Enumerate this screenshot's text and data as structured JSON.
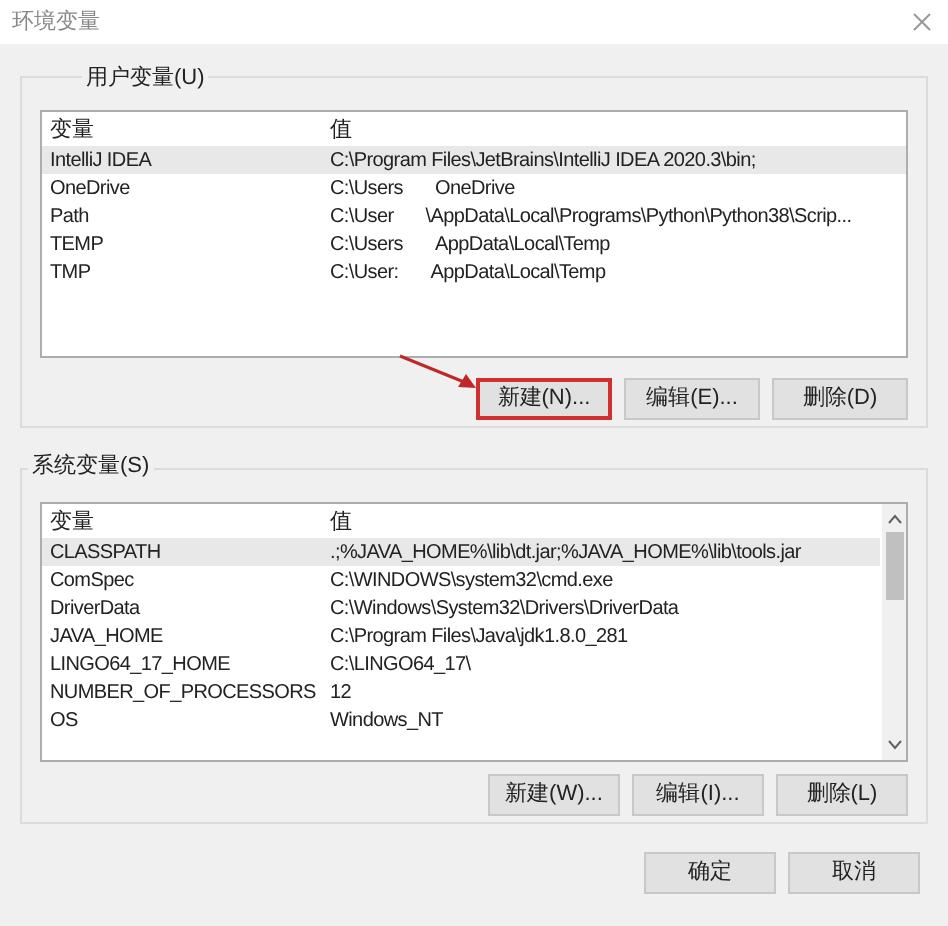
{
  "window": {
    "title": "环境变量"
  },
  "user_vars": {
    "label": "用户变量(U)",
    "columns": [
      "变量",
      "值"
    ],
    "rows": [
      {
        "name": "IntelliJ IDEA",
        "value": [
          "C:\\Program Files\\JetBrains\\IntelliJ IDEA 2020.3\\bin;"
        ],
        "selected": true
      },
      {
        "name": "OneDrive",
        "value": [
          "C:\\Users",
          "OneDrive"
        ],
        "selected": false
      },
      {
        "name": "Path",
        "value": [
          "C:\\User",
          "\\AppData\\Local\\Programs\\Python\\Python38\\Scrip..."
        ],
        "selected": false
      },
      {
        "name": "TEMP",
        "value": [
          "C:\\Users",
          "AppData\\Local\\Temp"
        ],
        "selected": false
      },
      {
        "name": "TMP",
        "value": [
          "C:\\User:",
          "AppData\\Local\\Temp"
        ],
        "selected": false
      }
    ],
    "buttons": [
      {
        "label": "新建(N)...",
        "highlighted": true
      },
      {
        "label": "编辑(E)...",
        "highlighted": false
      },
      {
        "label": "删除(D)",
        "highlighted": false
      }
    ]
  },
  "system_vars": {
    "label": "系统变量(S)",
    "columns": [
      "变量",
      "值"
    ],
    "rows": [
      {
        "name": "CLASSPATH",
        "value": [
          ".;%JAVA_HOME%\\lib\\dt.jar;%JAVA_HOME%\\lib\\tools.jar"
        ],
        "selected": true
      },
      {
        "name": "ComSpec",
        "value": [
          "C:\\WINDOWS\\system32\\cmd.exe"
        ],
        "selected": false
      },
      {
        "name": "DriverData",
        "value": [
          "C:\\Windows\\System32\\Drivers\\DriverData"
        ],
        "selected": false
      },
      {
        "name": "JAVA_HOME",
        "value": [
          "C:\\Program Files\\Java\\jdk1.8.0_281"
        ],
        "selected": false
      },
      {
        "name": "LINGO64_17_HOME",
        "value": [
          "C:\\LINGO64_17\\"
        ],
        "selected": false
      },
      {
        "name": "NUMBER_OF_PROCESSORS",
        "value": [
          "12"
        ],
        "selected": false
      },
      {
        "name": "OS",
        "value": [
          "Windows_NT"
        ],
        "selected": false
      }
    ],
    "buttons": [
      {
        "label": "新建(W)...",
        "highlighted": false
      },
      {
        "label": "编辑(I)...",
        "highlighted": false
      },
      {
        "label": "删除(L)",
        "highlighted": false
      }
    ]
  },
  "footer_buttons": [
    {
      "label": "确定"
    },
    {
      "label": "取消"
    }
  ]
}
